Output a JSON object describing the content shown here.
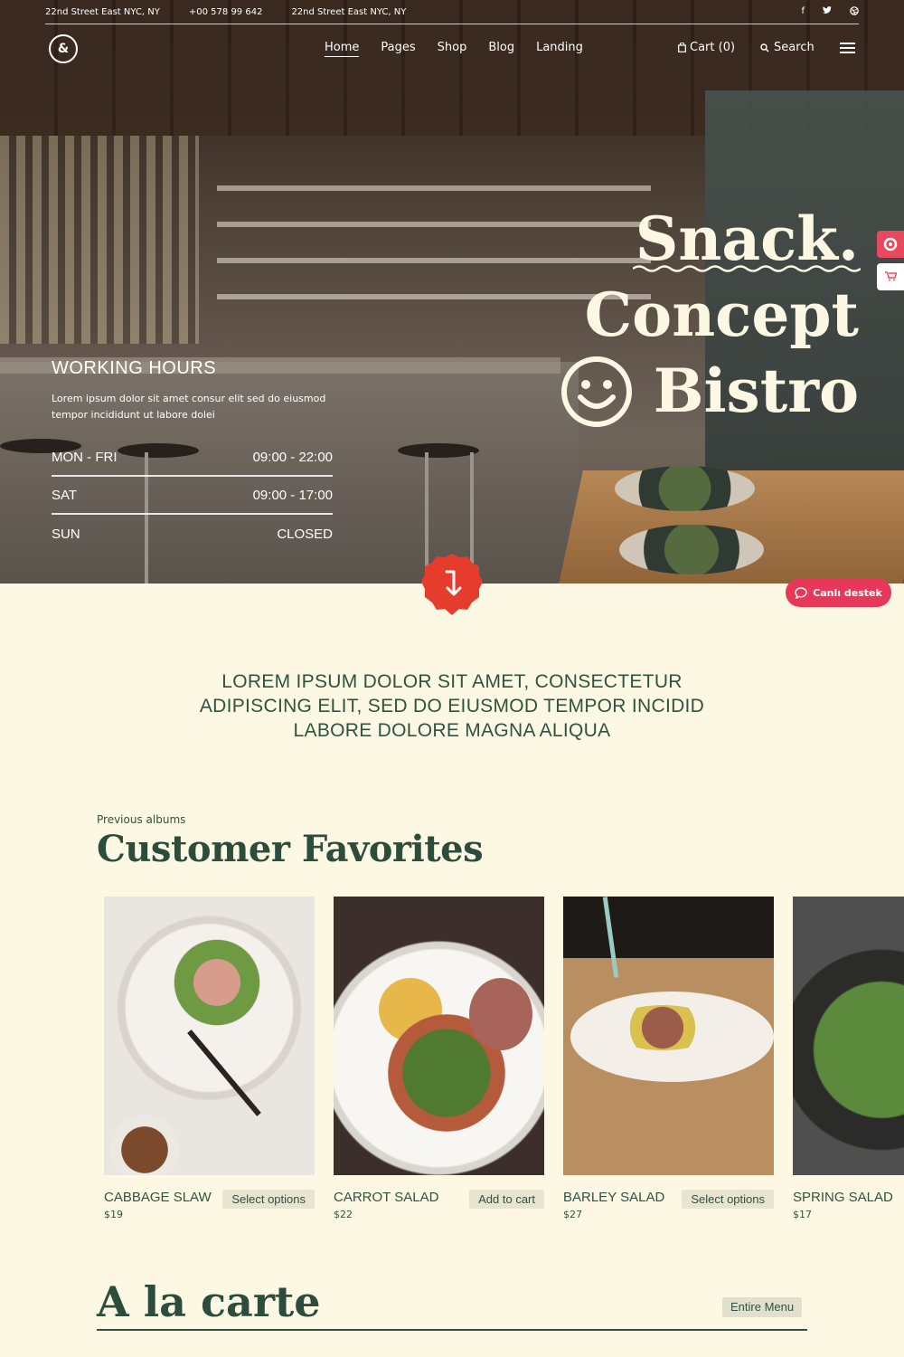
{
  "topbar": {
    "address_1": "22nd Street East NYC, NY",
    "phone": "+00 578 99 642",
    "address_2": "22nd Street East NYC, NY",
    "social_icons": [
      "facebook-icon",
      "twitter-icon",
      "dribbble-icon"
    ]
  },
  "nav": {
    "logo": "&",
    "items": [
      {
        "label": "Home",
        "active": true
      },
      {
        "label": "Pages"
      },
      {
        "label": "Shop"
      },
      {
        "label": "Blog"
      },
      {
        "label": "Landing"
      }
    ],
    "cart_label": "Cart (0)",
    "search_label": "Search"
  },
  "hours": {
    "title": "WORKING HOURS",
    "description": "Lorem ipsum dolor sit amet consur elit sed do eiusmod tempor incididunt ut labore dolei",
    "rows": [
      {
        "day": "MON - FRI",
        "time": "09:00 - 22:00"
      },
      {
        "day": "SAT",
        "time": "09:00 - 17:00"
      },
      {
        "day": "SUN",
        "time": "CLOSED"
      }
    ]
  },
  "headline": {
    "line1": "Snack.",
    "line2": "Concept",
    "line3": "Bistro"
  },
  "support": {
    "label": "Canlı destek"
  },
  "intro": {
    "text": "LOREM IPSUM DOLOR SIT AMET, CONSECTETUR ADIPISCING ELIT, SED DO EIUSMOD TEMPOR INCIDID LABORE DOLORE MAGNA ALIQUA"
  },
  "favorites": {
    "kicker": "Previous albums",
    "title": "Customer Favorites",
    "items": [
      {
        "name": "CABBAGE SLAW",
        "price": "$19",
        "button": "Select options"
      },
      {
        "name": "CARROT SALAD",
        "price": "$22",
        "button": "Add to cart"
      },
      {
        "name": "BARLEY SALAD",
        "price": "$27",
        "button": "Select options"
      },
      {
        "name": "SPRING SALAD",
        "price": "$17",
        "button": ""
      }
    ]
  },
  "alacarte": {
    "title": "A la carte",
    "button": "Entire Menu"
  },
  "colors": {
    "background": "#fdf8e4",
    "primary_green": "#2c4d3c",
    "accent_red": "#e8385a",
    "button_bg": "#e7e4d2"
  }
}
